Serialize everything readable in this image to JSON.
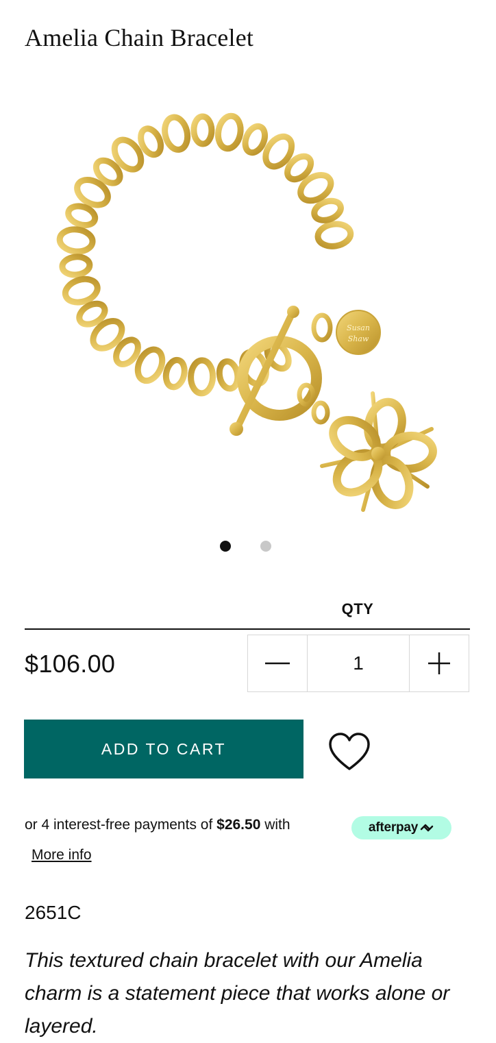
{
  "product": {
    "title": "Amelia Chain Bracelet",
    "price": "$106.00",
    "sku": "2651C",
    "description": "This textured chain bracelet with our Amelia charm is a statement piece that works alone or layered.",
    "charm_tag_text": "Susan Shaw"
  },
  "gallery": {
    "image_count": 2,
    "active_index": 0
  },
  "quantity": {
    "label": "QTY",
    "value": "1",
    "decrement_icon": "minus-icon",
    "increment_icon": "plus-icon"
  },
  "actions": {
    "add_to_cart_label": "ADD TO CART",
    "wishlist_icon": "heart-icon"
  },
  "afterpay": {
    "prefix": "or 4 interest-free payments of ",
    "amount": "$26.50",
    "suffix": " with",
    "badge_label": "afterpay",
    "more_info_label": "More info"
  },
  "colors": {
    "accent": "#006663",
    "afterpay_mint": "#b2fce4",
    "gold": "#d9b54a",
    "dot_active": "#111111",
    "dot_inactive": "#c8c8c8"
  }
}
